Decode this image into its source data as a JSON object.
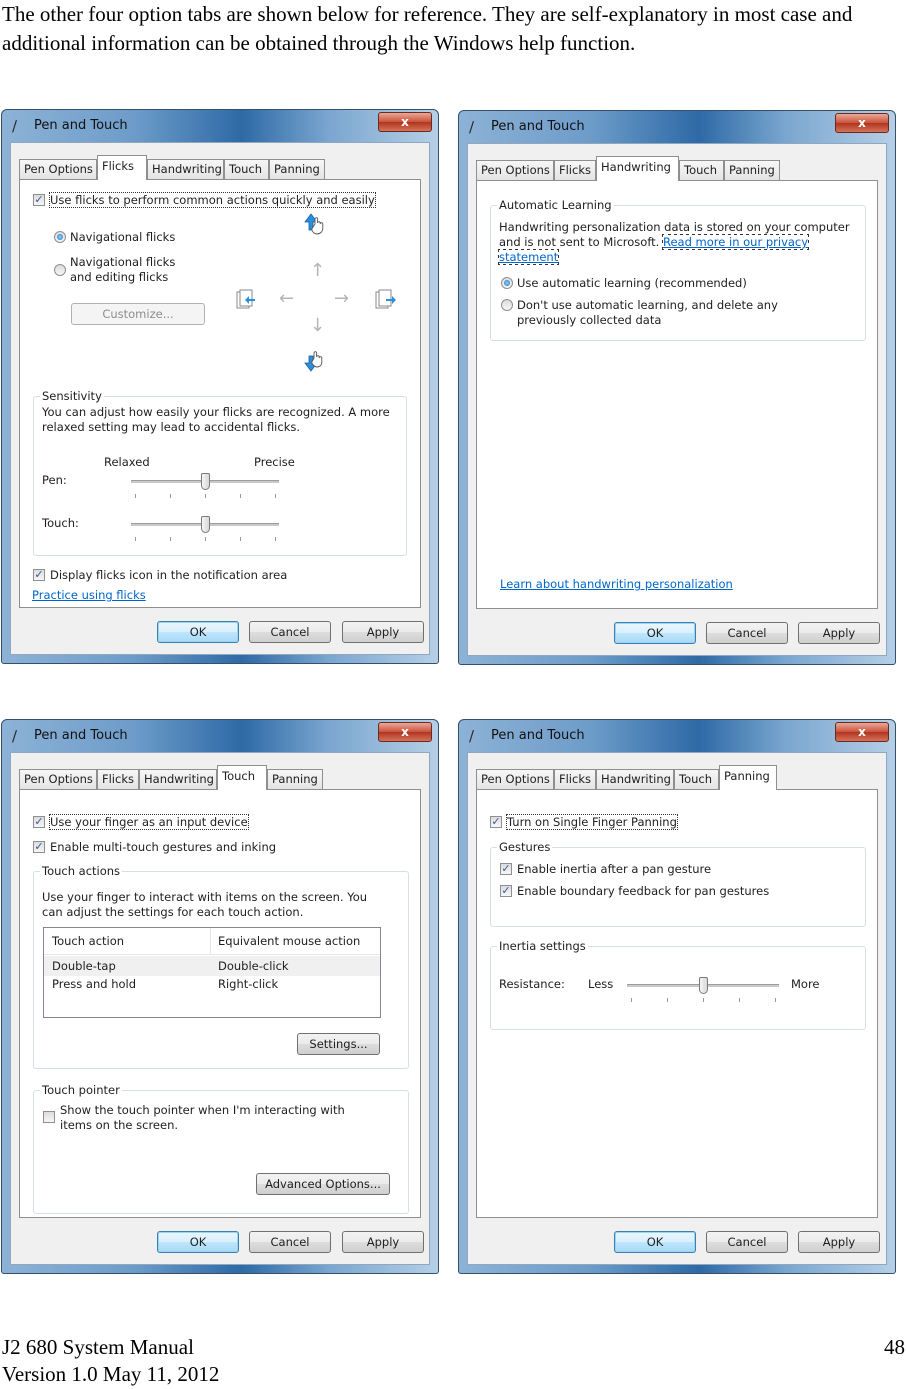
{
  "intro_text": "The other four option tabs are shown below for reference. They are self-explanatory in most case and additional information can be obtained through the Windows help function.",
  "footer": {
    "manual_title": "J2 680 System Manual",
    "version": "Version 1.0 May 11, 2012",
    "page_number": "48"
  },
  "dialog_common": {
    "title": "Pen and Touch",
    "close_glyph": "x",
    "tabs": [
      "Pen Options",
      "Flicks",
      "Handwriting",
      "Touch",
      "Panning"
    ],
    "ok_label": "OK",
    "cancel_label": "Cancel",
    "apply_label": "Apply"
  },
  "flicks": {
    "active_tab": "Flicks",
    "use_flicks_label": "Use flicks to perform common actions quickly and easily",
    "use_flicks_checked": true,
    "radio_navigational": "Navigational flicks",
    "radio_navigational_editing": "Navigational flicks and editing flicks",
    "selected_mode": "Navigational flicks",
    "customize_label": "Customize...",
    "sensitivity_title": "Sensitivity",
    "sensitivity_desc": "You can adjust how easily your flicks are recognized. A more relaxed setting may lead to accidental flicks.",
    "relaxed_label": "Relaxed",
    "precise_label": "Precise",
    "pen_label": "Pen:",
    "touch_label": "Touch:",
    "pen_sensitivity_level": 3,
    "touch_sensitivity_level": 3,
    "slider_levels": 5,
    "display_icon_label": "Display flicks icon in the notification area",
    "display_icon_checked": true,
    "practice_link": "Practice using flicks",
    "icons": [
      "up-flick-hand-icon",
      "copy-back-icon",
      "arrow-left-icon",
      "arrow-up-icon",
      "arrow-right-icon",
      "arrow-down-icon",
      "copy-forward-icon",
      "down-flick-hand-icon"
    ]
  },
  "handwriting": {
    "active_tab": "Handwriting",
    "group_title": "Automatic Learning",
    "description": "Handwriting personalization data is stored on your computer and is not sent to Microsoft.",
    "privacy_link": "Read more in our privacy statement",
    "radio_use": "Use automatic learning (recommended)",
    "radio_dont": "Don't use automatic learning, and delete any previously collected data",
    "selected": "Use automatic learning (recommended)",
    "learn_link": "Learn about handwriting personalization"
  },
  "touch": {
    "active_tab": "Touch",
    "use_finger_label": "Use your finger as an input device",
    "use_finger_checked": true,
    "multitouch_label": "Enable multi-touch gestures and inking",
    "multitouch_checked": true,
    "touch_actions_title": "Touch actions",
    "touch_actions_desc": "Use your finger to interact with items on the screen. You can adjust the settings for each touch action.",
    "table_headers": [
      "Touch action",
      "Equivalent mouse action"
    ],
    "table_rows": [
      {
        "action": "Double-tap",
        "mouse": "Double-click"
      },
      {
        "action": "Press and hold",
        "mouse": "Right-click"
      }
    ],
    "settings_label": "Settings...",
    "touch_pointer_title": "Touch pointer",
    "show_pointer_label": "Show the touch pointer when I'm interacting with items on the screen.",
    "show_pointer_checked": false,
    "advanced_label": "Advanced Options..."
  },
  "panning": {
    "active_tab": "Panning",
    "single_finger_label": "Turn on Single Finger Panning",
    "single_finger_checked": true,
    "gestures_title": "Gestures",
    "inertia_label": "Enable inertia after a pan gesture",
    "inertia_checked": true,
    "boundary_label": "Enable boundary feedback for pan gestures",
    "boundary_checked": true,
    "inertia_settings_title": "Inertia settings",
    "resistance_label": "Resistance:",
    "less_label": "Less",
    "more_label": "More",
    "resistance_level": 3,
    "slider_levels": 5
  }
}
